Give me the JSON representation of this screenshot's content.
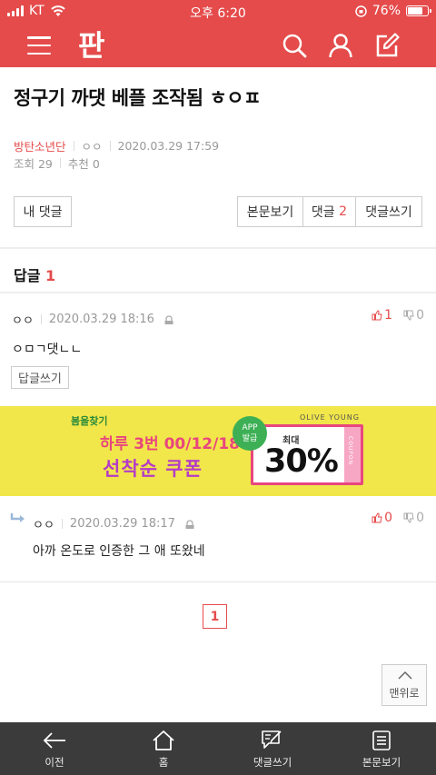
{
  "status_bar": {
    "carrier": "KT",
    "time": "오후 6:20",
    "battery": "76%",
    "battery_level": 0.76
  },
  "header": {
    "logo_text": "판"
  },
  "post": {
    "title": "정구기 까댓 베플 조작됨 ㅎㅇㅍ",
    "board": "방탄소년단",
    "author": "ㅇㅇ",
    "date": "2020.03.29 17:59",
    "views_label": "조회 29",
    "recommend_label": "추천 0"
  },
  "toolbar": {
    "my_comments": "내 댓글",
    "view_post": "본문보기",
    "comments_label": "댓글",
    "comments_count": "2",
    "write_comment": "댓글쓰기"
  },
  "replies": {
    "label": "답글",
    "count": "1"
  },
  "comments": [
    {
      "nick": "ㅇㅇ",
      "date": "2020.03.29 18:16",
      "text": "ㅇㅁㄱ댓ㄴㄴ",
      "up": "1",
      "down": "0",
      "reply_button": "답글쓰기"
    },
    {
      "nick": "ㅇㅇ",
      "date": "2020.03.29 18:17",
      "text": "아까 온도로 인증한 그 애 또왔네",
      "up": "0",
      "down": "0"
    }
  ],
  "ad": {
    "spring": "봄을찾기",
    "brand": "OLIVE YOUNG",
    "line1": "하루 3번 00/12/18시!",
    "line2": "선착순 쿠폰",
    "badge_line1": "APP",
    "badge_line2": "발급",
    "max_label": "최대",
    "percent": "30%",
    "coupon_word": "COUPON"
  },
  "pagination": {
    "current": "1"
  },
  "scroll_top": {
    "label": "맨위로"
  },
  "bottom_nav": [
    {
      "label": "이전",
      "icon": "back-arrow-icon"
    },
    {
      "label": "홈",
      "icon": "home-icon"
    },
    {
      "label": "댓글쓰기",
      "icon": "comment-write-icon"
    },
    {
      "label": "본문보기",
      "icon": "document-icon"
    }
  ],
  "colors": {
    "brand": "#e54b4b",
    "ad_bg": "#f1e64a",
    "bottom_bar": "#3b3b3b"
  }
}
